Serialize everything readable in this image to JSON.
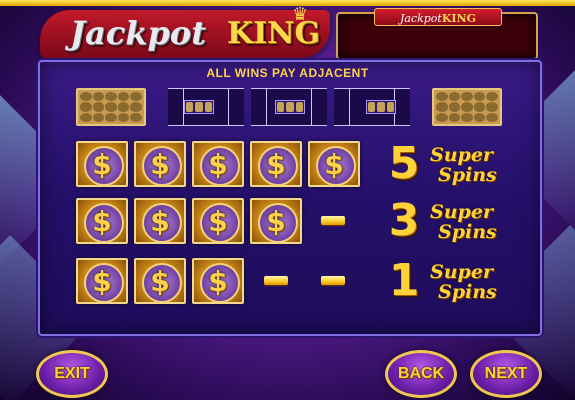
{
  "header": {
    "logo_jackpot": "Jackpot",
    "logo_king": "KING",
    "jackpot_banner_jackpot": "Jackpot",
    "jackpot_banner_king": "KING"
  },
  "paytable": {
    "heading": "ALL WINS PAY ADJACENT",
    "symbol_name": "dollar-coin",
    "symbol_glyph": "$",
    "rows": [
      {
        "symbols": 5,
        "dashes": 0,
        "count": "5",
        "award_line1": "Super",
        "award_line2": "Spins"
      },
      {
        "symbols": 4,
        "dashes": 1,
        "count": "3",
        "award_line1": "Super",
        "award_line2": "Spins"
      },
      {
        "symbols": 3,
        "dashes": 2,
        "count": "1",
        "award_line1": "Super",
        "award_line2": "Spins"
      }
    ]
  },
  "nav": {
    "exit_label": "EXIT",
    "back_label": "BACK",
    "next_label": "NEXT"
  },
  "colors": {
    "accent_gold": "#ffd23a",
    "panel_purple": "#24106a",
    "logo_red": "#c21a2a"
  }
}
